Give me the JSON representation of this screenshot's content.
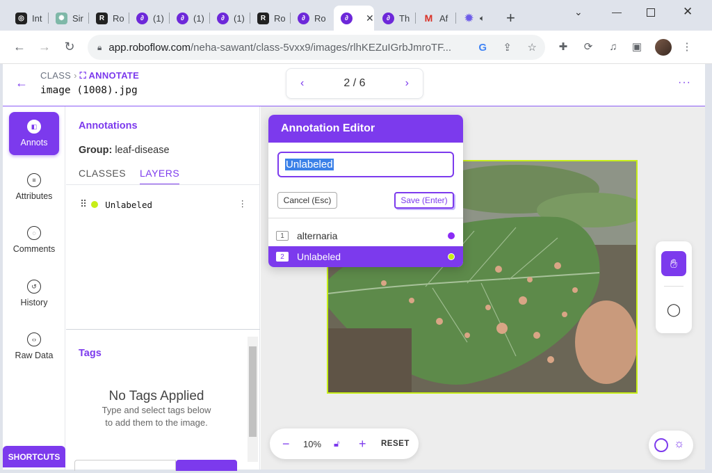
{
  "browser": {
    "tabs": [
      {
        "label": "Int",
        "fav": "dark"
      },
      {
        "label": "Sir",
        "fav": "gpt"
      },
      {
        "label": "Ro",
        "fav": "dark"
      },
      {
        "label": "(1)",
        "fav": "rf"
      },
      {
        "label": "(1)",
        "fav": "rf"
      },
      {
        "label": "(1)",
        "fav": "rf"
      },
      {
        "label": "Ro",
        "fav": "dark"
      },
      {
        "label": "Ro",
        "fav": "rf"
      },
      {
        "label": "",
        "fav": "rf",
        "active": true
      },
      {
        "label": "Th",
        "fav": "rf"
      },
      {
        "label": "Af",
        "fav": "gmail"
      },
      {
        "label": "",
        "fav": "star"
      }
    ],
    "url_host": "app.roboflow.com",
    "url_path": "/neha-sawant/class-5vxx9/images/rlhKEZuIGrbJmroTF..."
  },
  "header": {
    "crumb_project": "CLASS",
    "crumb_mode": "ANNOTATE",
    "filename": "image (1008).jpg",
    "pager": "2 / 6"
  },
  "sidebar": {
    "items": [
      {
        "label": "Annots",
        "icon": "annotations-icon"
      },
      {
        "label": "Attributes",
        "icon": "list-icon"
      },
      {
        "label": "Comments",
        "icon": "comment-icon"
      },
      {
        "label": "History",
        "icon": "history-icon"
      },
      {
        "label": "Raw Data",
        "icon": "code-icon"
      }
    ],
    "shortcuts": "SHORTCUTS"
  },
  "panel": {
    "title": "Annotations",
    "group_label": "Group:",
    "group_value": "leaf-disease",
    "tab_classes": "CLASSES",
    "tab_layers": "LAYERS",
    "layer_name": "Unlabeled",
    "tags_title": "Tags",
    "no_tags": "No Tags Applied",
    "no_tags_sub1": "Type and select tags below",
    "no_tags_sub2": "to add them to the image."
  },
  "editor": {
    "title": "Annotation Editor",
    "input_value": "Unlabeled",
    "cancel": "Cancel (Esc)",
    "save": "Save (Enter)",
    "options": [
      {
        "num": "1",
        "label": "alternaria",
        "color": "#8b2cf5"
      },
      {
        "num": "2",
        "label": "Unlabeled",
        "color": "#c7ee17"
      }
    ]
  },
  "zoom": {
    "value": "10%",
    "reset": "RESET"
  },
  "colors": {
    "accent": "#7c3aed",
    "bbox": "#c7ee17"
  }
}
